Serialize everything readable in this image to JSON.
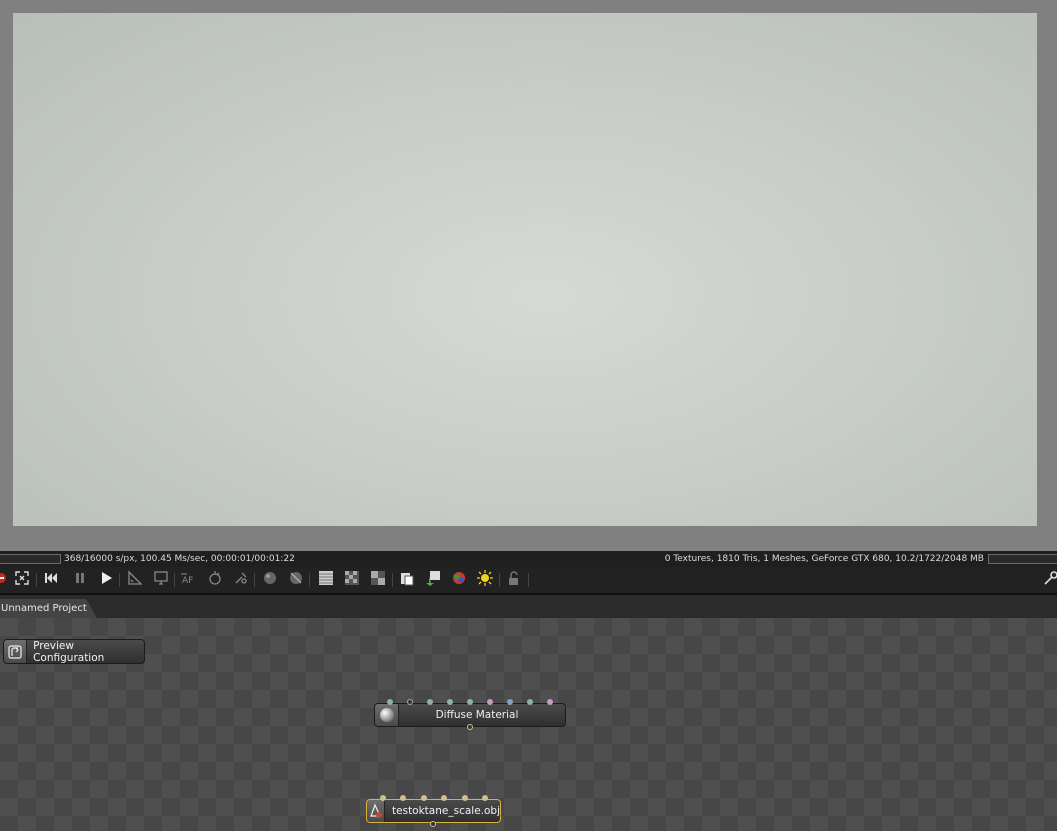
{
  "status": {
    "left": "368/16000 s/px, 100.45 Ms/sec, 00:00:01/00:01:22",
    "right": "0 Textures, 1810 Tris, 1 Meshes, GeForce GTX 680, 10.2/1722/2048 MB"
  },
  "tab": {
    "label": "Unnamed Project"
  },
  "nodes": {
    "preview": {
      "label": "Preview Configuration"
    },
    "material": {
      "label": "Diffuse Material"
    },
    "mesh": {
      "label": "testoktane_scale.obj"
    }
  },
  "toolbar": {
    "icons": [
      "reset-icon",
      "fit-icon",
      "rewind-icon",
      "pause-icon",
      "play-icon",
      "region-icon",
      "display-icon",
      "af-focus-icon",
      "white-balance-icon",
      "material-pick-icon",
      "clay-mode-icon",
      "clay-off-icon",
      "alpha-checker-icon",
      "checker-icon",
      "checker-small-icon",
      "clipboard-icon",
      "export-icon",
      "color-pick-icon",
      "lights-icon",
      "lock-icon",
      "settings-wrench-icon"
    ]
  },
  "colors": {
    "accent_selected": "#d6b43a",
    "viewport_center": "#d5dad6"
  }
}
